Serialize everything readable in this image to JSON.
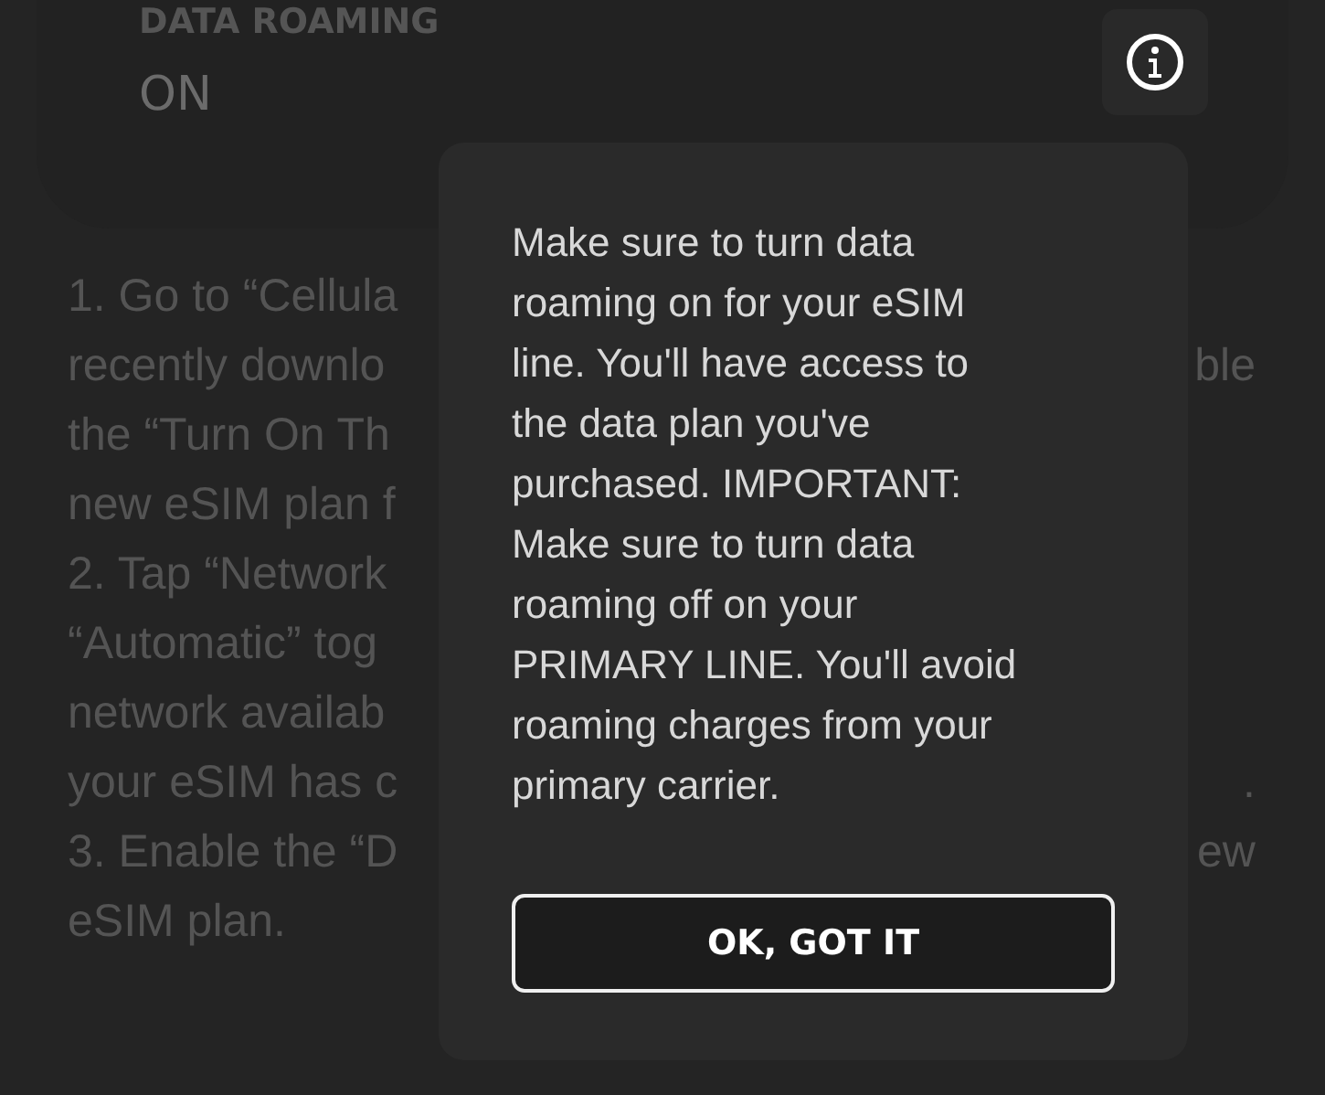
{
  "setting": {
    "label": "DATA ROAMING",
    "value": "ON"
  },
  "instructions": [
    {
      "left": "1. Go to “Cellula"
    },
    {
      "left": "recently downlo",
      "right": "ble"
    },
    {
      "left": "the “Turn On Th"
    },
    {
      "left": "new eSIM plan f"
    },
    {
      "left": "2. Tap “Network"
    },
    {
      "left": "“Automatic” tog"
    },
    {
      "left": "network availab"
    },
    {
      "left": "your eSIM has c",
      "right": "."
    },
    {
      "left": "3. Enable the “D",
      "right": "ew"
    },
    {
      "left": "eSIM plan."
    }
  ],
  "dialog": {
    "message_lines": [
      "Make sure to turn data",
      "roaming on for your eSIM",
      "line. You'll have access to",
      "the data plan you've",
      "purchased. IMPORTANT:",
      "Make sure to turn data",
      "roaming off on your",
      "PRIMARY LINE. You'll avoid",
      "roaming charges from your",
      "primary carrier."
    ],
    "button": "OK, GOT IT"
  }
}
